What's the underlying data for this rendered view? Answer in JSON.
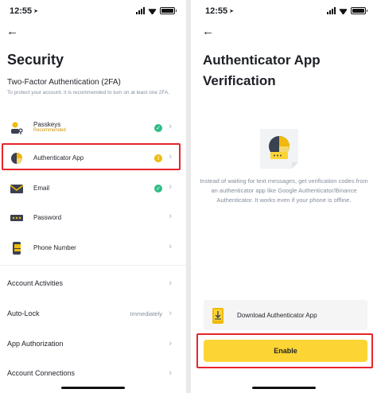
{
  "left": {
    "time": "12:55",
    "title": "Security",
    "tfa_heading": "Two-Factor Authentication (2FA)",
    "tfa_sub": "To protect your account, it is recommended to turn on at least one 2FA.",
    "items": [
      {
        "label": "Passkeys",
        "badge": "Recommended",
        "state": "✓"
      },
      {
        "label": "Authenticator App",
        "state": "!"
      },
      {
        "label": "Email",
        "state": "✓"
      },
      {
        "label": "Password"
      },
      {
        "label": "Phone Number"
      }
    ],
    "settings": [
      {
        "label": "Account Activities"
      },
      {
        "label": "Auto-Lock",
        "value": "Immediately"
      },
      {
        "label": "App Authorization"
      },
      {
        "label": "Account Connections"
      }
    ]
  },
  "right": {
    "time": "12:55",
    "title": "Authenticator App Verification",
    "description": "Instead of waiting for text messages, get verification codes from an authenticator app like Google Authenticator/Binance Authenticator. It works even if your phone is offline.",
    "download_label": "Download Authenticator App",
    "enable_label": "Enable"
  },
  "icons": {
    "back": "back-arrow-icon",
    "chevron": "chevron-right-icon",
    "location": "location-arrow-icon"
  },
  "colors": {
    "brand_yellow": "#FCD535",
    "success": "#2EBD85",
    "warning": "#F0B90B",
    "highlight_red": "#E8242A",
    "muted_text": "#848E9C"
  }
}
